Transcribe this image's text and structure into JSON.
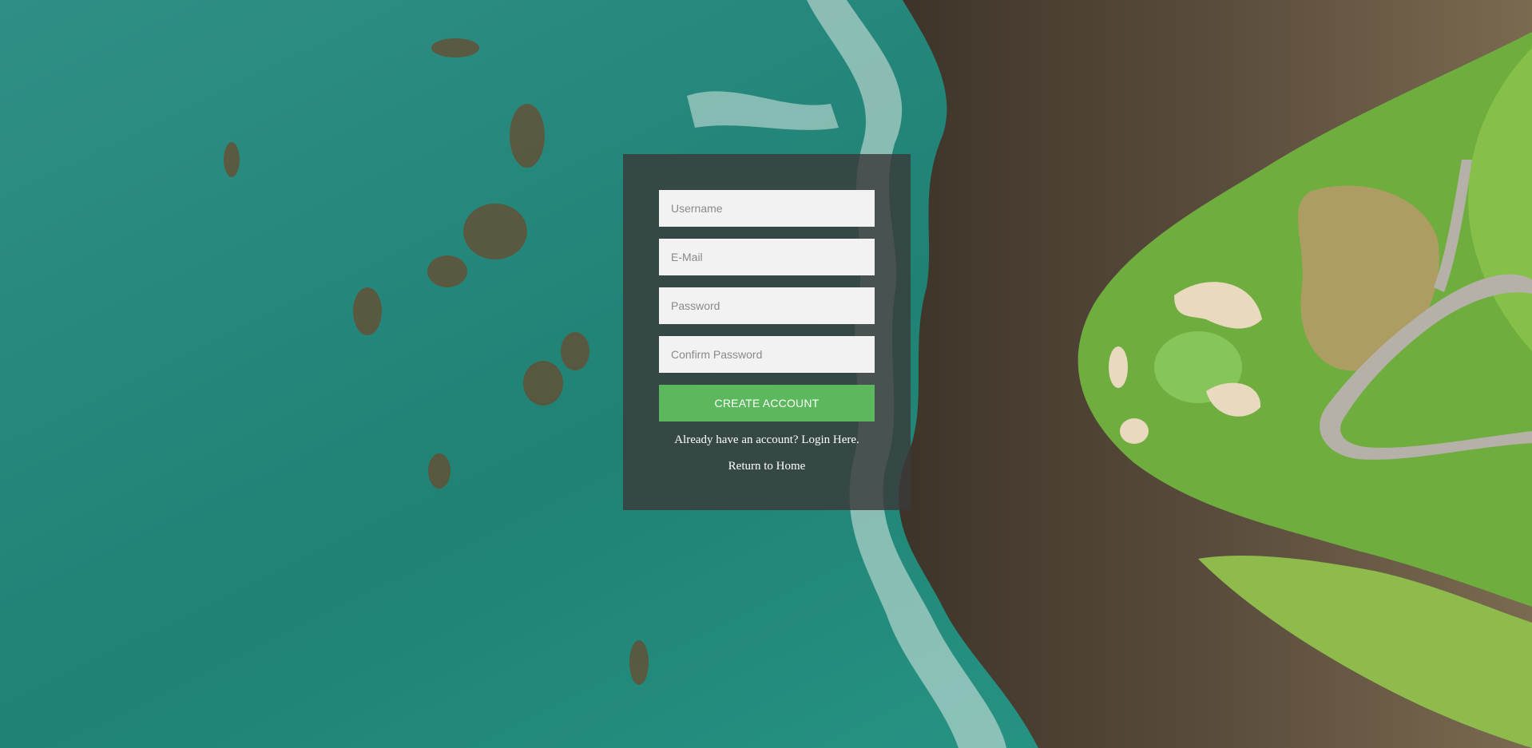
{
  "colors": {
    "panel_bg": "#3a3a3a",
    "field_bg": "#f2f2f2",
    "button_bg": "#5cb85c",
    "button_text": "#ffffff",
    "link_text": "#ffffff",
    "ocean": "#2a8a7c",
    "rock": "#4a3f34",
    "grass": "#6fae3e"
  },
  "background": {
    "description_icon": "aerial-coastline-background"
  },
  "form": {
    "username_placeholder": "Username",
    "email_placeholder": "E-Mail",
    "password_placeholder": "Password",
    "confirm_password_placeholder": "Confirm Password",
    "submit_label": "CREATE ACCOUNT",
    "login_prompt": "Already have an account?",
    "login_link": "Login Here.",
    "home_link": "Return to Home"
  }
}
